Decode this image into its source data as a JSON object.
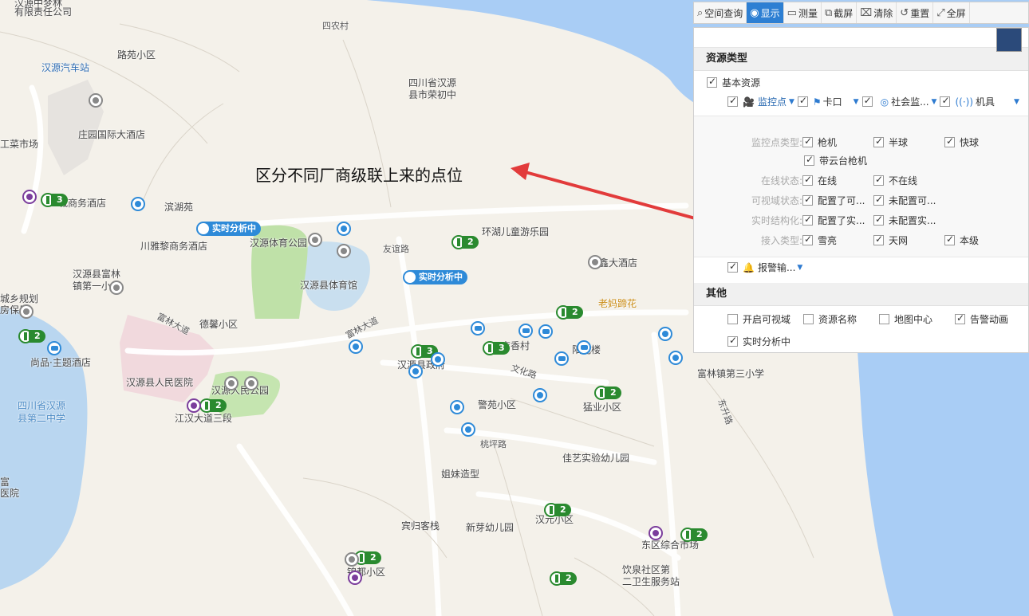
{
  "annotation": "区分不同厂商级联上来的点位",
  "map": {
    "labels": [
      {
        "text": "汉源汽车站",
        "cls": "blue"
      },
      {
        "text": "路苑小区",
        "cls": ""
      },
      {
        "text": "四农村",
        "cls": "road"
      },
      {
        "text": "四川省汉源",
        "cls": ""
      },
      {
        "text": "县市荣初中",
        "cls": ""
      },
      {
        "text": "庄园国际大酒店",
        "cls": ""
      },
      {
        "text": "工菜市场",
        "cls": ""
      },
      {
        "text": "城商务酒店",
        "cls": ""
      },
      {
        "text": "滨湖苑",
        "cls": ""
      },
      {
        "text": "川雅黎商务酒店",
        "cls": ""
      },
      {
        "text": "汉源体育公园",
        "cls": ""
      },
      {
        "text": "环湖儿童游乐园",
        "cls": ""
      },
      {
        "text": "友谊路",
        "cls": "road"
      },
      {
        "text": "汉源县体育馆",
        "cls": ""
      },
      {
        "text": "鑫大酒店",
        "cls": ""
      },
      {
        "text": "汉源县富林",
        "cls": ""
      },
      {
        "text": "镇第一小",
        "cls": ""
      },
      {
        "text": "城乡规划",
        "cls": ""
      },
      {
        "text": "房保局",
        "cls": ""
      },
      {
        "text": "德馨小区",
        "cls": ""
      },
      {
        "text": "老妈蹄花",
        "cls": "orange"
      },
      {
        "text": "富林大道",
        "cls": "road"
      },
      {
        "text": "富林大道",
        "cls": "road"
      },
      {
        "text": "尚品·主题酒店",
        "cls": ""
      },
      {
        "text": "汉源县人民医院",
        "cls": ""
      },
      {
        "text": "汉源人民公园",
        "cls": ""
      },
      {
        "text": "江汉大道三段",
        "cls": ""
      },
      {
        "text": "四川省汉源",
        "cls": "water"
      },
      {
        "text": "县第二中学",
        "cls": "water"
      },
      {
        "text": "汉源县政府",
        "cls": ""
      },
      {
        "text": "吉香村",
        "cls": ""
      },
      {
        "text": "阳光楼",
        "cls": ""
      },
      {
        "text": "文化路",
        "cls": "road"
      },
      {
        "text": "富林镇第三小学",
        "cls": ""
      },
      {
        "text": "警苑小区",
        "cls": ""
      },
      {
        "text": "猛业小区",
        "cls": ""
      },
      {
        "text": "东升路",
        "cls": "road"
      },
      {
        "text": "桃坪路",
        "cls": "road"
      },
      {
        "text": "佳艺实验幼儿园",
        "cls": ""
      },
      {
        "text": "姐妹造型",
        "cls": ""
      },
      {
        "text": "富",
        "cls": ""
      },
      {
        "text": "医院",
        "cls": ""
      },
      {
        "text": "宾归客栈",
        "cls": ""
      },
      {
        "text": "新芽幼儿园",
        "cls": ""
      },
      {
        "text": "汉元小区",
        "cls": ""
      },
      {
        "text": "东区综合市场",
        "cls": ""
      },
      {
        "text": "饮泉社区第",
        "cls": ""
      },
      {
        "text": "二卫生服务站",
        "cls": ""
      },
      {
        "text": "锦都小区",
        "cls": ""
      },
      {
        "text": "汉源中梦林",
        "cls": ""
      },
      {
        "text": "有限责任公司",
        "cls": ""
      }
    ],
    "clusters": [
      "3",
      "2",
      "2",
      "3",
      "3",
      "2",
      "2",
      "2",
      "2",
      "2",
      "2",
      "2"
    ],
    "realtime_tags": [
      "实时分析中",
      "实时分析中"
    ]
  },
  "toolbar": {
    "items": [
      {
        "icon": "spatial-query-icon",
        "label": "空间查询",
        "active": false
      },
      {
        "icon": "display-icon",
        "label": "显示",
        "active": true
      },
      {
        "icon": "measure-icon",
        "label": "测量",
        "active": false
      },
      {
        "icon": "screenshot-icon",
        "label": "截屏",
        "active": false
      },
      {
        "icon": "clear-icon",
        "label": "清除",
        "active": false
      },
      {
        "icon": "reset-icon",
        "label": "重置",
        "active": false
      },
      {
        "icon": "fullscreen-icon",
        "label": "全屏",
        "active": false
      }
    ]
  },
  "panel": {
    "resource_title": "资源类型",
    "basic": "基本资源",
    "types": [
      "监控点",
      "卡口",
      "社会监...",
      "机具"
    ],
    "filters": {
      "type_label": "监控点类型:",
      "type_opts": [
        "枪机",
        "半球",
        "快球",
        "带云台枪机"
      ],
      "online_label": "在线状态:",
      "online_opts": [
        "在线",
        "不在线"
      ],
      "visual_label": "可视域状态:",
      "visual_opts": [
        "配置了可...",
        "未配置可..."
      ],
      "struct_label": "实时结构化:",
      "struct_opts": [
        "配置了实...",
        "未配置实..."
      ],
      "access_label": "接入类型:",
      "access_opts": [
        "雪亮",
        "天网",
        "本级"
      ]
    },
    "alarm": "报警输...",
    "other_title": "其他",
    "other": [
      "开启可视域",
      "资源名称",
      "地图中心",
      "告警动画",
      "实时分析中"
    ]
  }
}
